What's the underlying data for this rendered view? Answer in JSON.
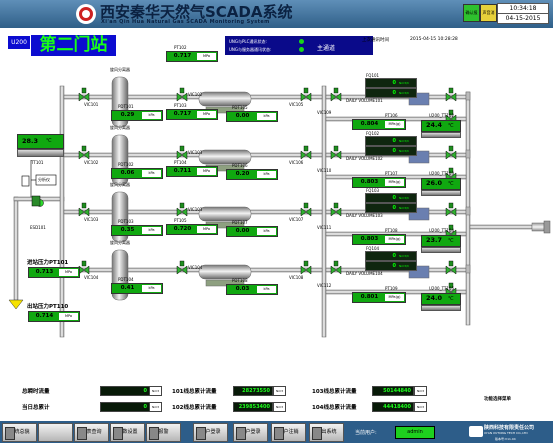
{
  "header": {
    "title_cn": "西安秦华天然气SCADA系统",
    "title_en": "Xi'an Qin Hua Natural Gas SCADA Monitoring System",
    "buttons": [
      "确认报警",
      "声音消除"
    ],
    "time": "10:34:18",
    "date": "04-15-2015"
  },
  "station": {
    "code": "U200",
    "name": "第二门站",
    "status_plc": "UNG与PLC通讯状态:",
    "status_server": "UNG与服务器通讯状态:",
    "mode": "主通道",
    "update_label": "上次通讯时间",
    "update_time": "2015-04-15 10:28:28"
  },
  "inlet": {
    "temp_value": "28.3",
    "temp_unit": "℃",
    "tt_tag": "TT101",
    "filter_label": "分析仪",
    "valve_tag": "ESD101",
    "pressure_in_label": "进站压力PT101",
    "pressure_in_value": "0.713",
    "pressure_in_unit": "MPa",
    "pressure_out_label": "出站压力PT110",
    "pressure_out_value": "0.714",
    "pressure_out_unit": "MPa"
  },
  "lines": [
    {
      "pt_top": "PT102",
      "pt_top_value": "0.717",
      "pt_top_unit": "MPa",
      "separator": "旋风分离器",
      "pdt": "PDT101",
      "pdt_value": "0.29",
      "pdt_unit": "kPa",
      "pdt2": "PDT105",
      "pdt2_value": "0.00",
      "pdt2_unit": "kPa",
      "v_in": "VIC101",
      "v_mid": "VIC102",
      "v_out": "VIC105",
      "v_meter": "VIC109",
      "fq": "FQ101",
      "flow1": "0",
      "flow1_unit": "Nm3/h",
      "flow2": "0",
      "flow2_unit": "Nm3/h",
      "daily_label": "DAILY VOLUME101",
      "pt_meter": "PT106",
      "pt_meter_value": "0.804",
      "pt_meter_unit": "MPa(g)",
      "tt_meter": "U200_TT102",
      "temp": "24.4",
      "temp_unit": "℃"
    },
    {
      "pt_top": "PT103",
      "pt_top_value": "0.717",
      "pt_top_unit": "MPa",
      "separator": "旋风分离器",
      "pdt": "PDT102",
      "pdt_value": "0.06",
      "pdt_unit": "kPa",
      "pdt2": "PDT106",
      "pdt2_value": "0.20",
      "pdt2_unit": "kPa",
      "v_in": "VIC102",
      "v_mid": "VIC103",
      "v_out": "VIC106",
      "v_meter": "VIC110",
      "fq": "FQ102",
      "flow1": "0",
      "flow1_unit": "Nm3/h",
      "flow2": "0",
      "flow2_unit": "Nm3/h",
      "daily_label": "DAILY VOLUME102",
      "pt_meter": "PT107",
      "pt_meter_value": "0.803",
      "pt_meter_unit": "MPa(g)",
      "tt_meter": "U200_TT103",
      "temp": "26.0",
      "temp_unit": "℃"
    },
    {
      "pt_top": "PT104",
      "pt_top_value": "0.711",
      "pt_top_unit": "MPa",
      "separator": "旋风分离器",
      "pdt": "PDT103",
      "pdt_value": "0.35",
      "pdt_unit": "kPa",
      "pdt2": "PDT107",
      "pdt2_value": "0.00",
      "pdt2_unit": "kPa",
      "v_in": "VIC103",
      "v_mid": "VIC103",
      "v_out": "VIC107",
      "v_meter": "VIC111",
      "fq": "FQ103",
      "flow1": "0",
      "flow1_unit": "Nm3/h",
      "flow2": "0",
      "flow2_unit": "Nm3/h",
      "daily_label": "DAILY VOLUME103",
      "pt_meter": "PT108",
      "pt_meter_value": "0.803",
      "pt_meter_unit": "MPa(g)",
      "tt_meter": "U200_TT104",
      "temp": "23.7",
      "temp_unit": "℃"
    },
    {
      "pt_top": "PT105",
      "pt_top_value": "0.720",
      "pt_top_unit": "MPa",
      "separator": "旋风分离器",
      "pdt": "PDT104",
      "pdt_value": "0.41",
      "pdt_unit": "kPa",
      "pdt2": "PDT108",
      "pdt2_value": "0.03",
      "pdt2_unit": "kPa",
      "v_in": "VIC104",
      "v_mid": "VIC104",
      "v_out": "VIC108",
      "v_meter": "VIC112",
      "fq": "FQ104",
      "flow1": "0",
      "flow1_unit": "Nm3/h",
      "flow2": "0",
      "flow2_unit": "Nm3/h",
      "daily_label": "DAILY VOLUME104",
      "pt_meter": "PT109",
      "pt_meter_value": "0.801",
      "pt_meter_unit": "MPa(g)",
      "tt_meter": "U200_TT105",
      "temp": "24.0",
      "temp_unit": "℃"
    }
  ],
  "totals": {
    "instant_label": "总瞬时流量",
    "instant_value": "0",
    "instant_unit": "Nm3",
    "today_label": "当日总累计",
    "today_value": "0",
    "today_unit": "Nm3",
    "l101_label": "101线总累计流量",
    "l101_value": "28273550",
    "l101_unit": "Nm3",
    "l102_label": "102线总累计流量",
    "l102_value": "239853400",
    "l102_unit": "Nm3",
    "l103_label": "103线总累计流量",
    "l103_value": "50144840",
    "l103_unit": "Nm3",
    "l104_label": "104线总累计流量",
    "l104_value": "44418400",
    "l104_unit": "Nm3",
    "function_label": "功能选择菜单"
  },
  "toolbar": {
    "buttons": [
      "系统总貌",
      "报表查询",
      "参数设置",
      "报警",
      "用户登录",
      "用户登录",
      "用户注销",
      "退出系统"
    ],
    "current_user_label": "当前用户:",
    "current_user": "admin",
    "brand": "陕西科技有限责任公司",
    "brand_en": "XI'AN XUTONG TECH CO.,LTD",
    "version": "版本号:V11.04"
  },
  "colors": {
    "header": "#2f5f88",
    "station_bg": "#0c0cd0",
    "value_green": "#10a810",
    "toolbar": "#2d5d89"
  }
}
